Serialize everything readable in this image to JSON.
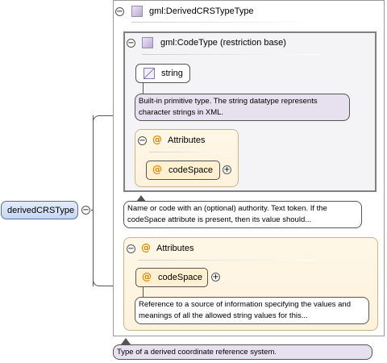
{
  "root": {
    "label": "derivedCRSType",
    "toggle": "−"
  },
  "type_header": {
    "label": "gml:DerivedCRSTypeType",
    "toggle": "−"
  },
  "code_type": {
    "label": "gml:CodeType (restriction base)",
    "toggle": "−"
  },
  "string_item": {
    "label": "string"
  },
  "string_doc": "Built-in primitive type. The string datatype represents character strings in XML.",
  "inner_attributes": {
    "label": "Attributes",
    "toggle": "−",
    "at": "@",
    "item": {
      "label": "codeSpace",
      "at": "@",
      "expand": "+"
    }
  },
  "code_type_doc": "Name or code with an (optional) authority. Text token. If the codeSpace attribute is present, then its value should...",
  "outer_attributes": {
    "label": "Attributes",
    "toggle": "−",
    "at": "@",
    "item": {
      "label": "codeSpace",
      "at": "@",
      "expand": "+"
    }
  },
  "codespace_doc": "Reference to a source of information specifying the values and meanings of all the allowed string values for this...",
  "type_doc": "Type of a derived coordinate reference system."
}
